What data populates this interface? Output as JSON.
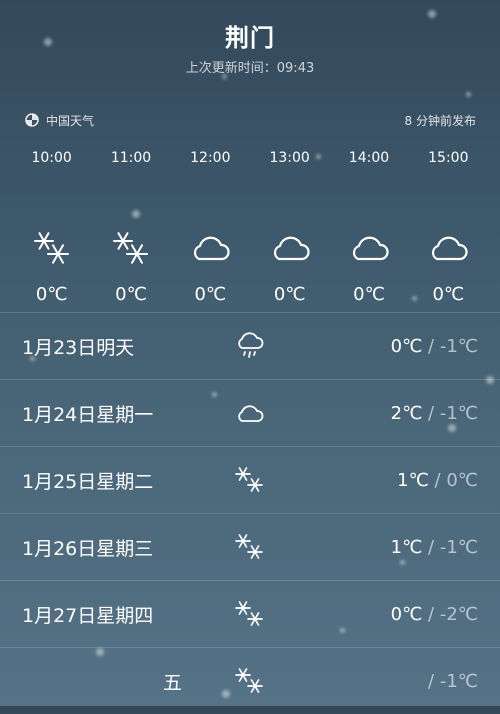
{
  "header": {
    "city": "荆门",
    "updated": "上次更新时间：09:43"
  },
  "source": {
    "name": "中国天气",
    "published": "8 分钟前发布"
  },
  "hourly": [
    {
      "time": "10:00",
      "icon": "snow-icon",
      "temp": "0℃"
    },
    {
      "time": "11:00",
      "icon": "snow-icon",
      "temp": "0℃"
    },
    {
      "time": "12:00",
      "icon": "cloud-icon",
      "temp": "0℃"
    },
    {
      "time": "13:00",
      "icon": "cloud-icon",
      "temp": "0℃"
    },
    {
      "time": "14:00",
      "icon": "cloud-icon",
      "temp": "0℃"
    },
    {
      "time": "15:00",
      "icon": "cloud-icon",
      "temp": "0℃"
    }
  ],
  "daily": [
    {
      "label": "1月23日明天",
      "icon": "rain-cloud-icon",
      "high": "0℃",
      "low": "-1℃"
    },
    {
      "label": "1月24日星期一",
      "icon": "cloud-icon",
      "high": "2℃",
      "low": "-1℃"
    },
    {
      "label": "1月25日星期二",
      "icon": "snow-icon",
      "high": "1℃",
      "low": "0℃"
    },
    {
      "label": "1月26日星期三",
      "icon": "snow-icon",
      "high": "1℃",
      "low": "-1℃"
    },
    {
      "label": "1月27日星期四",
      "icon": "snow-icon",
      "high": "0℃",
      "low": "-2℃"
    },
    {
      "label": "五",
      "icon": "snow-icon",
      "high": "",
      "low": "-1℃"
    }
  ]
}
